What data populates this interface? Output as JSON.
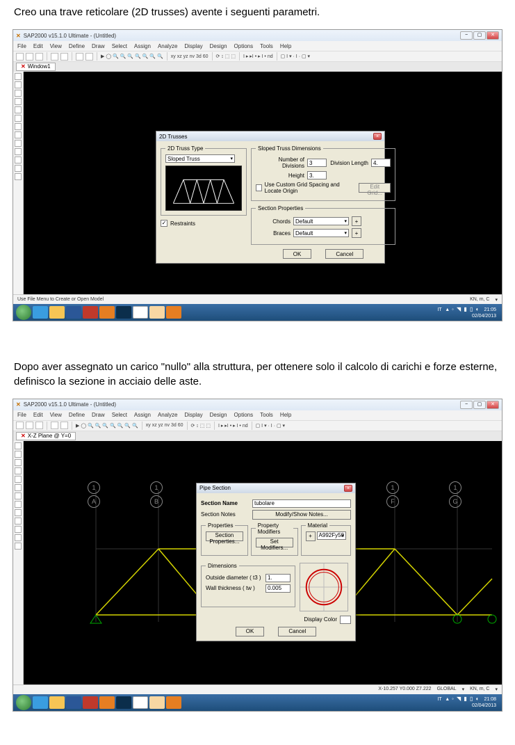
{
  "caption1": "Creo una trave reticolare (2D trusses) avente i seguenti parametri.",
  "caption2": "Dopo aver assegnato un carico \"nullo\" alla struttura, per ottenere solo il calcolo di carichi e forze esterne, definisco la sezione in acciaio delle aste.",
  "app_title": "SAP2000 v15.1.0 Ultimate - (Untitled)",
  "menus": [
    "File",
    "Edit",
    "View",
    "Define",
    "Draw",
    "Select",
    "Assign",
    "Analyze",
    "Display",
    "Design",
    "Options",
    "Tools",
    "Help"
  ],
  "toolbar_middle": "xy  xz  yz  nv  3d  60",
  "toolbar_right": "I ▸ ▸I • ▸ I •  nd",
  "tab1": "Window1",
  "tab2": "X-Z Plane @ Y=0",
  "status1": "Use File Menu to Create or Open Model",
  "status1r": "KN, m, C",
  "status2l": "X-10.257  Y0.000  Z7.222",
  "status2c": "GLOBAL",
  "status2r": "KN, m, C",
  "tray_lang": "IT",
  "tray_icons": "▴ ◦ ◥ ▮ ▯ ◐",
  "tray_time1": "21:05",
  "tray_time2": "21:08",
  "tray_date": "02/04/2013",
  "dlg1": {
    "title": "2D Trusses",
    "fs_type": "2D Truss Type",
    "type_value": "Sloped Truss",
    "fs_dim": "Sloped Truss Dimensions",
    "num_div": "Number of Divisions",
    "num_div_v": "3",
    "height": "Height",
    "height_v": "3.",
    "div_len": "Division Length",
    "div_len_v": "4.",
    "custom": "Use Custom Grid Spacing and Locate Origin",
    "edit_grid": "Edit Grid...",
    "fs_sect": "Section Properties",
    "chords": "Chords",
    "braces": "Braces",
    "default": "Default",
    "restraints": "Restraints",
    "ok": "OK",
    "cancel": "Cancel"
  },
  "dlg2": {
    "title": "Pipe Section",
    "sect_name": "Section Name",
    "sect_name_v": "tubolare",
    "sect_notes": "Section Notes",
    "modify_notes": "Modify/Show Notes...",
    "properties": "Properties",
    "prop_mod": "Property Modifiers",
    "material": "Material",
    "sect_props": "Section Properties...",
    "set_mods": "Set Modifiers...",
    "material_v": "A992Fy50",
    "dimensions": "Dimensions",
    "out_dia": "Outside diameter  ( t3 )",
    "out_dia_v": "1.",
    "wall_th": "Wall thickness  ( tw )",
    "wall_th_v": "0.005",
    "disp_color": "Display Color",
    "ok": "OK",
    "cancel": "Cancel"
  },
  "nodes": [
    "1",
    "A",
    "1",
    "B",
    "1",
    "F",
    "1",
    "G"
  ]
}
